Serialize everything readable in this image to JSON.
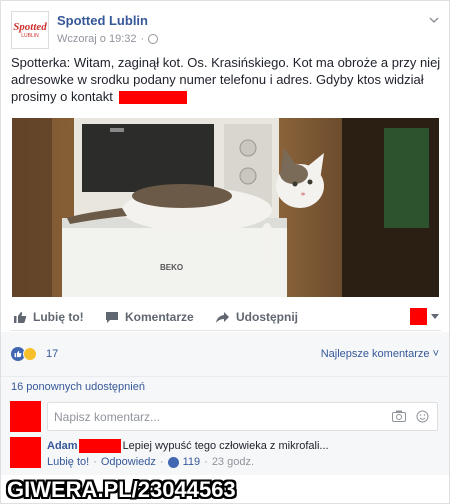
{
  "post": {
    "page_name": "Spotted Lublin",
    "avatar_logo": "Spotted",
    "avatar_logo_sub": "LUBLIN",
    "timestamp": "Wczoraj o 19:32",
    "separator": "·",
    "text_part1": "Spotterka: Witam, zaginął kot. Os. Krasińskiego. Kot ma obroże a przy niej adresowke w srodku podany numer telefonu i adres. Gdyby ktos widział prosimy o kontakt",
    "photo_brand": "BEKO"
  },
  "actions": {
    "like_label": "Lubię to!",
    "comment_label": "Komentarze",
    "share_label": "Udostępnij"
  },
  "reactions": {
    "count": "17",
    "sort_label": "Najlepsze komentarze ˅"
  },
  "shares": {
    "label": "16 ponownych udostępnień"
  },
  "comment_input": {
    "placeholder": "Napisz komentarz..."
  },
  "comment": {
    "author": "Adam",
    "text": "Lepiej wypuść tego człowieka z mikrofali...",
    "like_link": "Lubię to!",
    "sep1": "·",
    "reply_link": "Odpowiedz",
    "sep2": "·",
    "likes": "119",
    "sep3": "·",
    "time": "23 godz."
  },
  "watermark": "GIWERA.PL/23044563",
  "colors": {
    "link_blue": "#365899",
    "redaction": "#ff0000",
    "like_blue": "#4267b2"
  }
}
